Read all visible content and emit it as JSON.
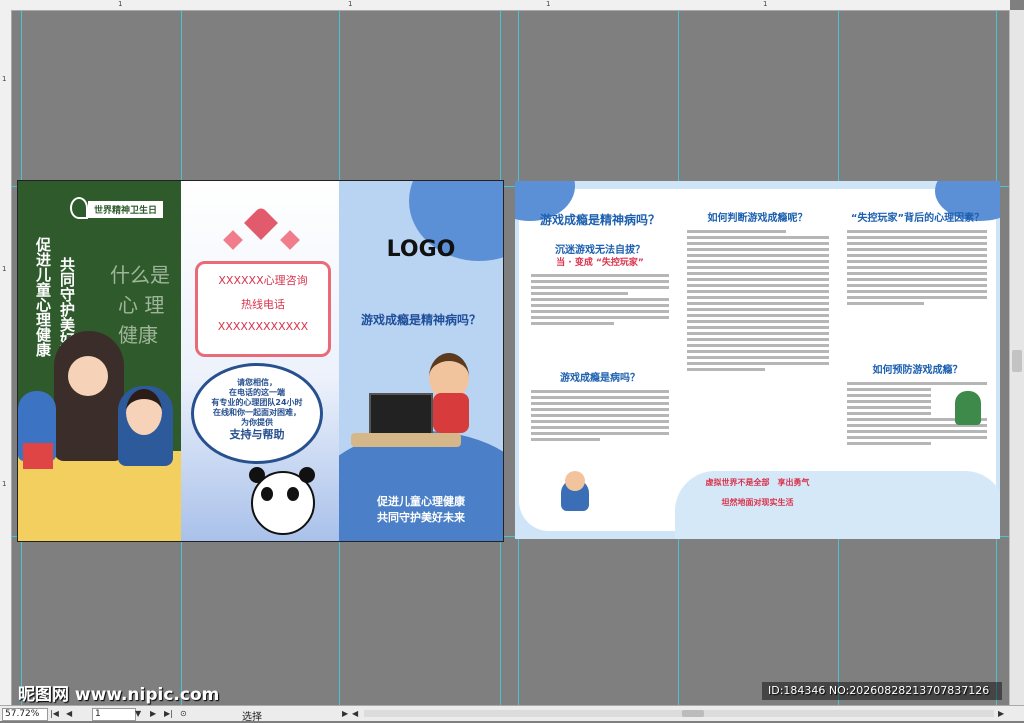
{
  "status": {
    "zoom": "57.72%",
    "page_number": "1",
    "tool_hint": "选择"
  },
  "front": {
    "p1": {
      "badge": "世界精神卫生日",
      "slogan_left": "促进儿童心理健康",
      "slogan_right": "共同守护美好未来",
      "chalk": [
        "什么是",
        "心 理",
        "健康"
      ]
    },
    "p2": {
      "hotline_title": "XXXXXX心理咨询",
      "hotline_label": "热线电话",
      "hotline_number": "XXXXXXXXXXXX",
      "bubble_lines": [
        "请您相信，",
        "在电话的这一端",
        "有专业的心理团队24小时",
        "在线和你一起面对困难，",
        "为你提供"
      ],
      "bubble_emphasis": "支持与帮助"
    },
    "p3": {
      "logo": "LOGO",
      "question": "游戏成瘾是精神病吗？",
      "slogan_1": "促进儿童心理健康",
      "slogan_2": "共同守护美好未来"
    }
  },
  "back": {
    "col1": {
      "title": "游戏成瘾是精神病吗？",
      "q1": "沉迷游戏无法自拔？",
      "q1_sub": "当 · 变成 “失控玩家”",
      "q2": "游戏成瘾是病吗？"
    },
    "col2": {
      "title": "如何判断游戏成瘾呢？",
      "banner_1": "虚拟世界不是全部　享出勇气",
      "banner_2": "坦然地面对现实生活"
    },
    "col3": {
      "title": "“失控玩家”背后的心理因素？",
      "title2": "如何预防游戏成瘾？"
    }
  },
  "watermark": {
    "left": "昵图网 www.nipic.com",
    "right": "ID:184346 NO:20260828213707837126"
  },
  "colors": {
    "canvas": "#7f7f7f",
    "guide": "#3fd0e0",
    "dark_green": "#2e5a2c",
    "accent_blue": "#1d60b0",
    "accent_red": "#d8344d"
  }
}
